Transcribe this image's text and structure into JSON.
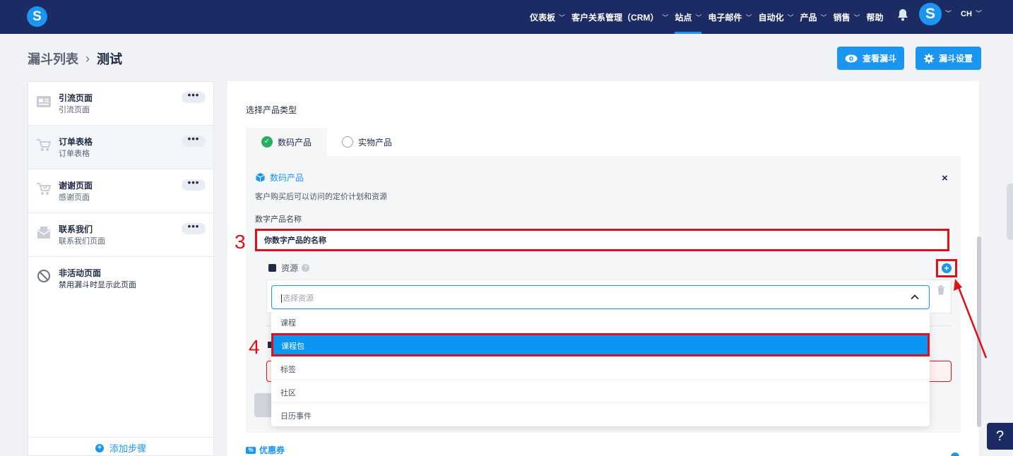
{
  "app": {
    "logo_letter": "S",
    "brand_color": "#1c2b64",
    "accent_color": "#1a96f0",
    "annotation_color": "#e0101a"
  },
  "nav": {
    "items": [
      {
        "label": "仪表板",
        "caret": true
      },
      {
        "label": "客户关系管理（CRM）",
        "caret": true
      },
      {
        "label": "站点",
        "caret": true,
        "active": true
      },
      {
        "label": "电子邮件",
        "caret": true
      },
      {
        "label": "自动化",
        "caret": true
      },
      {
        "label": "产品",
        "caret": true
      },
      {
        "label": "销售",
        "caret": true
      },
      {
        "label": "帮助",
        "caret": false
      }
    ],
    "avatar_letter": "S",
    "language": "CH"
  },
  "header": {
    "breadcrumb_parent": "漏斗列表",
    "breadcrumb_sep": "›",
    "breadcrumb_current": "测试",
    "view_funnel_label": "查看漏斗",
    "funnel_settings_label": "漏斗设置"
  },
  "sidebar": {
    "steps": [
      {
        "title": "引流页面",
        "subtitle": "引流页面",
        "icon": "landing-page-icon",
        "more": "•••"
      },
      {
        "title": "订单表格",
        "subtitle": "订单表格",
        "icon": "cart-icon",
        "more": "•••"
      },
      {
        "title": "谢谢页面",
        "subtitle": "感谢页面",
        "icon": "cart-check-icon",
        "more": "•••"
      },
      {
        "title": "联系我们",
        "subtitle": "联系我们页面",
        "icon": "mail-icon",
        "more": "•••"
      }
    ],
    "inactive_title": "非活动页面",
    "inactive_subtitle": "禁用漏斗时显示此页面",
    "add_step_label": "添加步骤"
  },
  "main": {
    "product_type_label": "选择产品类型",
    "tab_digital": "数码产品",
    "tab_physical": "实物产品",
    "card_title": "数码产品",
    "card_desc": "客户购买后可以访问的定价计划和资源",
    "name_label": "数字产品名称",
    "name_value": "你数字产品的名称",
    "resources_label": "资源",
    "help_mark": "?",
    "select_placeholder": "选择资源",
    "dropdown_options": [
      "课程",
      "课程包",
      "标签",
      "社区",
      "日历事件"
    ],
    "highlighted_option": "课程包",
    "coupon_label": "优惠券",
    "close_symbol": "×"
  },
  "annotations": {
    "step3": "3",
    "step4": "4"
  },
  "help_fab": "?"
}
